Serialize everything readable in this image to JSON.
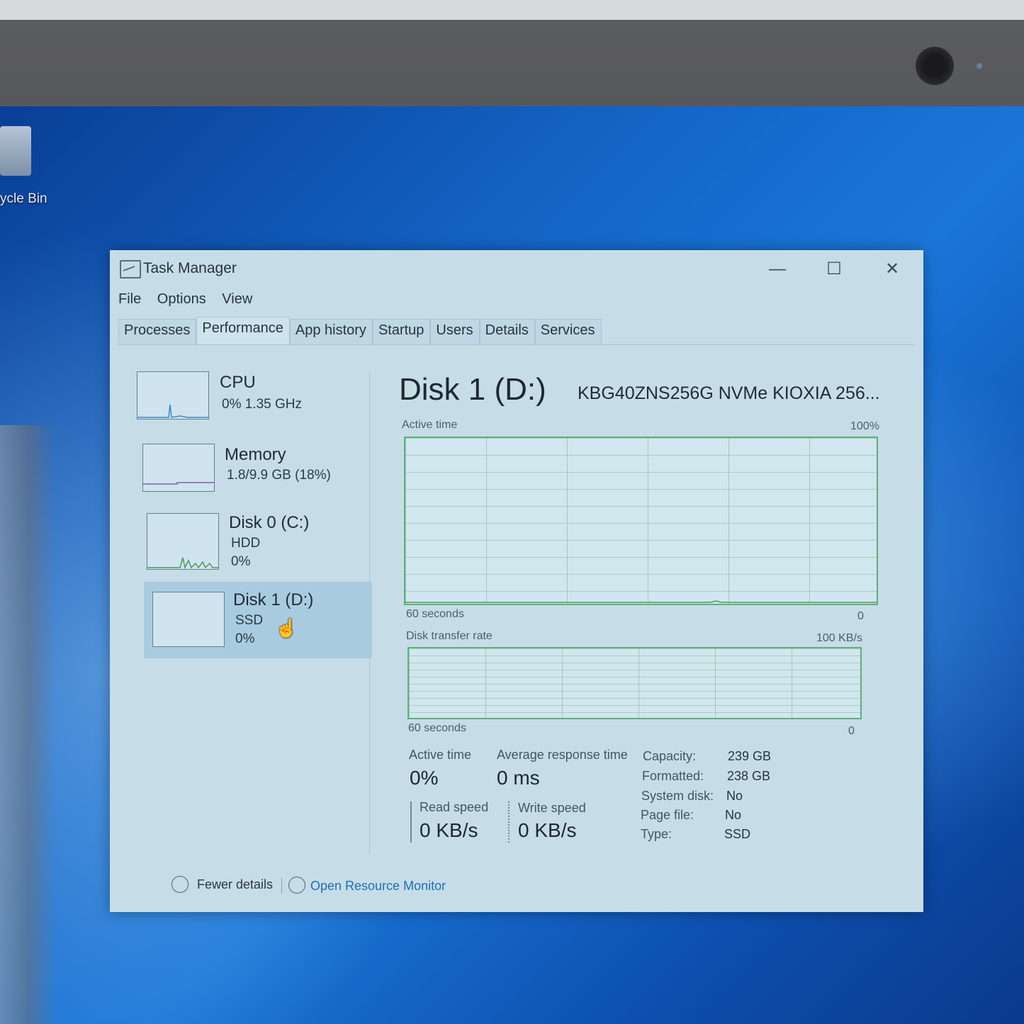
{
  "desktop": {
    "recycle_bin_label": "ycle Bin"
  },
  "window": {
    "title": "Task Manager",
    "controls": {
      "minimize": "—",
      "maximize": "☐",
      "close": "✕"
    }
  },
  "menu": [
    "File",
    "Options",
    "View"
  ],
  "tabs": [
    "Processes",
    "Performance",
    "App history",
    "Startup",
    "Users",
    "Details",
    "Services"
  ],
  "active_tab": "Performance",
  "sidebar": [
    {
      "name": "CPU",
      "line1": "0%  1.35 GHz",
      "line2": ""
    },
    {
      "name": "Memory",
      "line1": "1.8/9.9 GB (18%)",
      "line2": ""
    },
    {
      "name": "Disk 0 (C:)",
      "line1": "HDD",
      "line2": "0%"
    },
    {
      "name": "Disk 1 (D:)",
      "line1": "SSD",
      "line2": "0%"
    }
  ],
  "detail": {
    "title": "Disk 1 (D:)",
    "model": "KBG40ZNS256G NVMe KIOXIA 256...",
    "graph1": {
      "label": "Active time",
      "max": "100%",
      "x_left": "60 seconds",
      "x_right": "0"
    },
    "graph2": {
      "label": "Disk transfer rate",
      "max": "100 KB/s",
      "x_left": "60 seconds",
      "x_right": "0"
    },
    "stats": {
      "active_time_label": "Active time",
      "active_time_value": "0%",
      "avg_resp_label": "Average response time",
      "avg_resp_value": "0 ms",
      "read_label": "Read speed",
      "read_value": "0 KB/s",
      "write_label": "Write speed",
      "write_value": "0 KB/s"
    },
    "properties": [
      {
        "k": "Capacity:",
        "v": "239 GB"
      },
      {
        "k": "Formatted:",
        "v": "238 GB"
      },
      {
        "k": "System disk:",
        "v": "No"
      },
      {
        "k": "Page file:",
        "v": "No"
      },
      {
        "k": "Type:",
        "v": "SSD"
      }
    ]
  },
  "footer": {
    "fewer_details": "Fewer details",
    "open_resource_monitor": "Open Resource Monitor"
  },
  "colors": {
    "graph_border": "#5fae7c",
    "selection": "#a9cbe0",
    "link": "#1f6fb3"
  }
}
